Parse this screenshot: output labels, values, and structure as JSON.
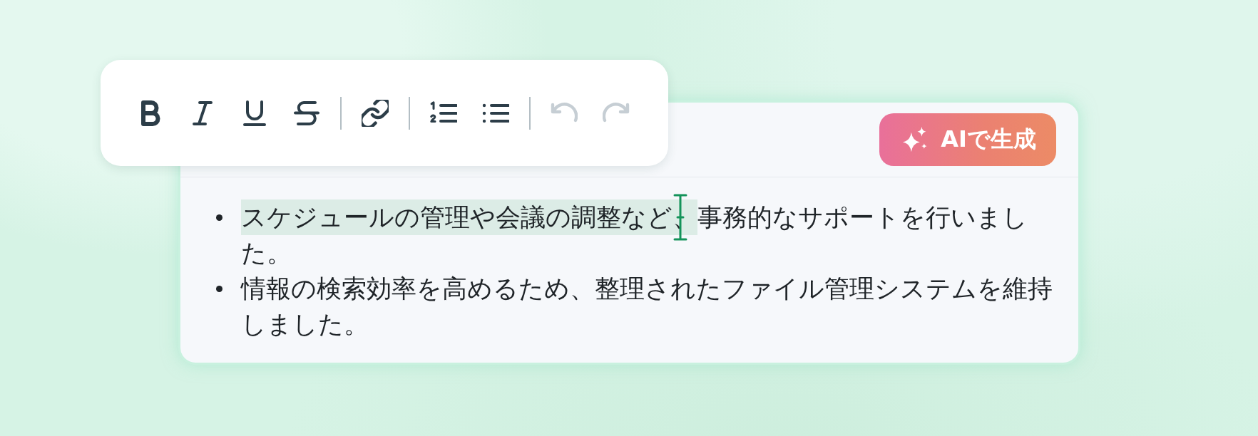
{
  "toolbar": {
    "groups": [
      {
        "tools": [
          {
            "kind": "bold",
            "disabled": false
          },
          {
            "kind": "italic",
            "disabled": false
          },
          {
            "kind": "underline",
            "disabled": false
          },
          {
            "kind": "strikethrough",
            "disabled": false
          }
        ]
      },
      {
        "tools": [
          {
            "kind": "link",
            "disabled": false
          }
        ]
      },
      {
        "tools": [
          {
            "kind": "numbered-list",
            "disabled": false
          },
          {
            "kind": "bulleted-list",
            "disabled": false
          }
        ]
      },
      {
        "tools": [
          {
            "kind": "undo",
            "disabled": true
          },
          {
            "kind": "redo",
            "disabled": true
          }
        ]
      }
    ]
  },
  "editor": {
    "generate_button": {
      "label": "AIで生成"
    },
    "list_items": [
      {
        "segments": [
          {
            "text": "スケジュールの管理や会議の調整など、",
            "selected": true
          },
          {
            "text": "事務的なサポートを行いました。",
            "selected": false
          }
        ]
      },
      {
        "segments": [
          {
            "text": "情報の検索効率を高めるため、整理されたファイル管理システムを維持しました。",
            "selected": false
          }
        ]
      }
    ]
  }
}
